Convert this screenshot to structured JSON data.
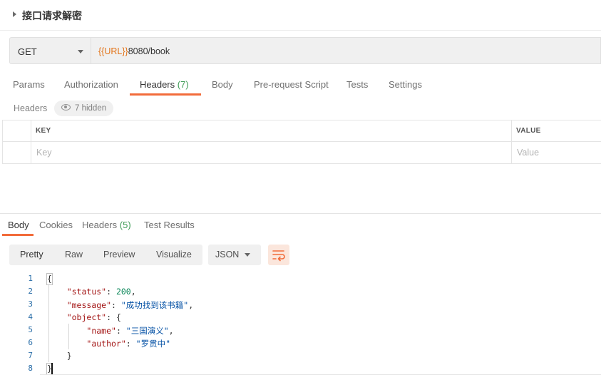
{
  "request": {
    "title": "接口请求解密",
    "method": "GET",
    "url_variable": "{{URL}}",
    "url_rest": "8080/book"
  },
  "request_tabs": [
    {
      "label": "Params"
    },
    {
      "label": "Authorization"
    },
    {
      "label": "Headers",
      "count": "(7)",
      "active": true
    },
    {
      "label": "Body"
    },
    {
      "label": "Pre-request Script"
    },
    {
      "label": "Tests"
    },
    {
      "label": "Settings"
    }
  ],
  "headers_panel": {
    "label": "Headers",
    "hidden_text": "7 hidden",
    "columns": {
      "key": "KEY",
      "value": "VALUE"
    },
    "placeholders": {
      "key": "Key",
      "value": "Value"
    }
  },
  "response_tabs": [
    {
      "label": "Body",
      "active": true
    },
    {
      "label": "Cookies"
    },
    {
      "label": "Headers",
      "count": "(5)"
    },
    {
      "label": "Test Results"
    }
  ],
  "view_modes": [
    "Pretty",
    "Raw",
    "Preview",
    "Visualize"
  ],
  "active_view": "Pretty",
  "format": "JSON",
  "code": {
    "line_numbers": [
      "1",
      "2",
      "3",
      "4",
      "5",
      "6",
      "7",
      "8"
    ],
    "lines": [
      "{",
      "    \"status\": 200,",
      "    \"message\": \"成功找到该书籍\",",
      "    \"object\": {",
      "        \"name\": \"三国演义\",",
      "        \"author\": \"罗贯中\"",
      "    }",
      "}"
    ]
  },
  "colors": {
    "accent": "#f26b3a",
    "count_green": "#3f9c56",
    "url_variable": "#e3761c",
    "json_key": "#a31515",
    "json_string": "#0451a5",
    "json_number": "#098658"
  },
  "icons": {
    "title_caret": "caret-right-icon",
    "method_dropdown": "chevron-down-icon",
    "hidden_eye": "eye-icon",
    "format_dropdown": "chevron-down-icon",
    "wrap": "wrap-lines-icon"
  }
}
